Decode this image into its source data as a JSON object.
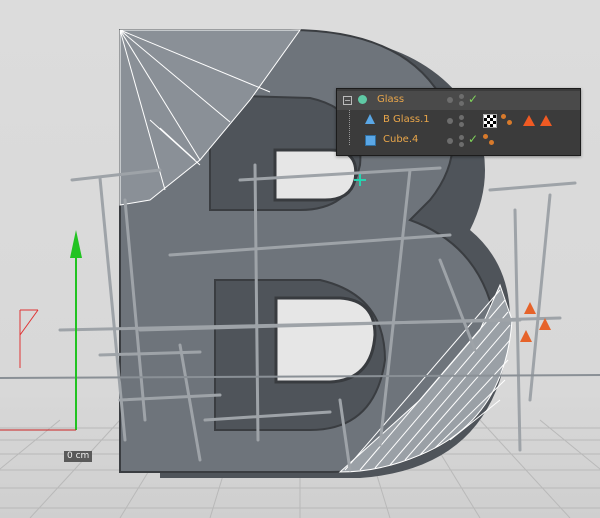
{
  "viewport": {
    "coordinate_label": "0 cm"
  },
  "object_manager": {
    "rows": [
      {
        "name": "Glass",
        "color": "#e9a64a",
        "icon": "null-object-icon",
        "has_check": true
      },
      {
        "name": "B Glass.1",
        "color": "#e9a64a",
        "icon": "extrude-icon",
        "has_check": false
      },
      {
        "name": "Cube.4",
        "color": "#e9a64a",
        "icon": "cube-icon",
        "has_check": true
      }
    ],
    "check_color": "#7fd35a"
  }
}
